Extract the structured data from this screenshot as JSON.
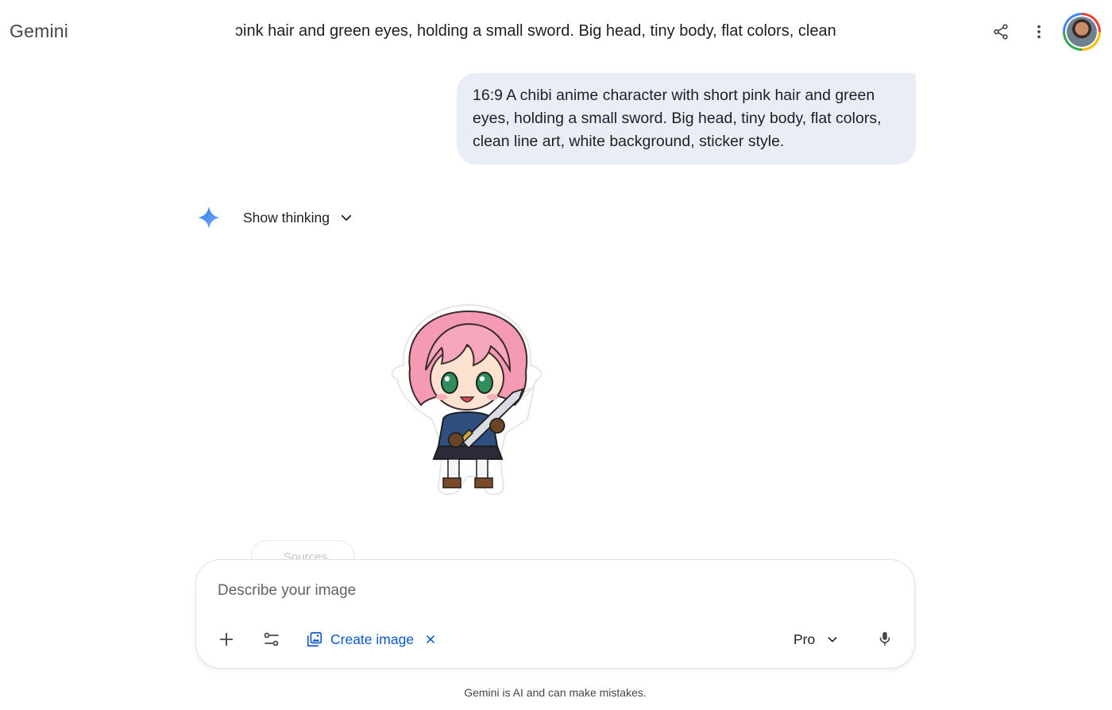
{
  "header": {
    "app_title": "Gemini",
    "conversation_title": "ɔink hair and green eyes, holding a small sword. Big head, tiny body, flat colors, clean",
    "share_icon": "share-icon",
    "more_icon": "more-vert-icon"
  },
  "conversation": {
    "user_message": "16:9 A chibi anime character with short pink hair and green eyes, holding a small sword. Big head, tiny body, flat colors, clean line art, white background, sticker style.",
    "response": {
      "avatar_icon": "gemini-spark-icon",
      "show_thinking_label": "Show thinking",
      "sources_label": "Sources"
    }
  },
  "composer": {
    "placeholder": "Describe your image",
    "value": "",
    "create_image_label": "Create image",
    "model_label": "Pro"
  },
  "footer": {
    "disclaimer": "Gemini is AI and can make mistakes."
  },
  "colors": {
    "accent_blue": "#0b57d0",
    "user_bubble": "#e9eef6",
    "spark_start": "#1a73e8",
    "spark_end": "#8ab4f8"
  }
}
